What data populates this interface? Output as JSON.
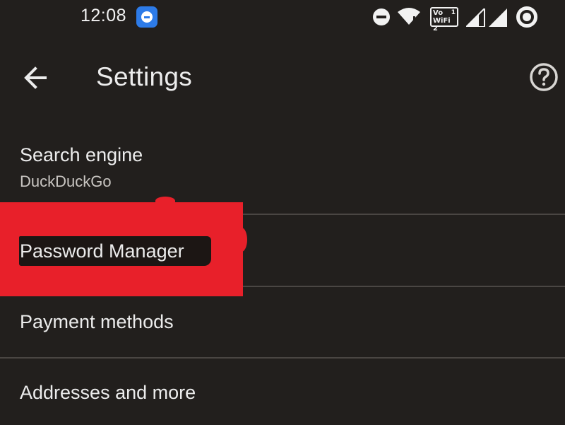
{
  "status_bar": {
    "time": "12:08",
    "volte_line1": "Vo",
    "volte_line2": "WiFi 2",
    "sim_badge": "1",
    "icons": [
      "blue-app-notification-icon",
      "do-not-disturb-icon",
      "wifi-icon",
      "volte-wifi-icon",
      "signal-icon",
      "signal-icon",
      "data-saver-icon"
    ]
  },
  "toolbar": {
    "title": "Settings",
    "back_icon": "arrow-back-icon",
    "help_icon": "help-circle-icon"
  },
  "settings": {
    "items": [
      {
        "label": "Search engine",
        "sublabel": "DuckDuckGo"
      },
      {
        "label": "Password Manager"
      },
      {
        "label": "Payment methods"
      },
      {
        "label": "Addresses and more"
      }
    ]
  },
  "annotation": {
    "color": "#e8202a"
  },
  "colors": {
    "background": "#221f1d",
    "text_primary": "#ececec",
    "text_secondary": "#c9c6c2",
    "divider": "#4a4643",
    "notification_accent": "#2d7be8"
  }
}
